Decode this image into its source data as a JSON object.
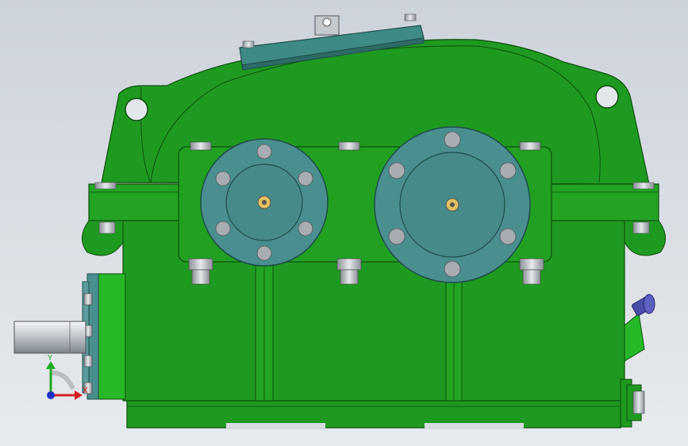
{
  "viewport": {
    "background_top": "#cdd3db",
    "background_bottom": "#e7eaee"
  },
  "model": {
    "body_color": "#1f9a20",
    "body_color_dark": "#147014",
    "body_color_light": "#3cc23c",
    "flange_color": "#4a8f8f",
    "flange_color_dark": "#2f6a6a",
    "shaft_color": "#c9ced3",
    "valve_color": "#4b4ea8"
  },
  "triad": {
    "x_label": "X",
    "y_label": "Y",
    "x_color": "#d32020",
    "y_color": "#1eaa1e",
    "z_color": "#2030c0"
  }
}
